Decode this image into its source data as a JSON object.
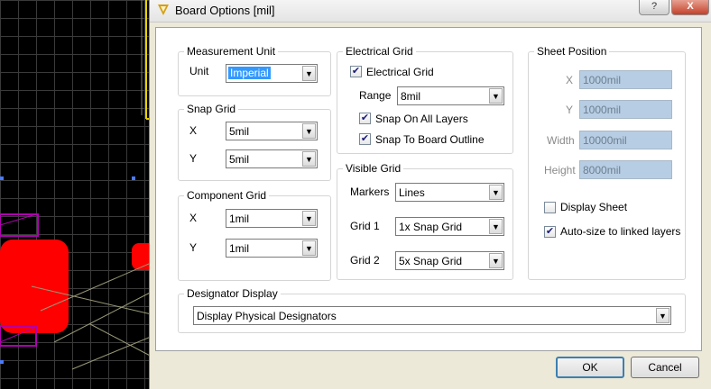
{
  "window": {
    "title": "Board Options [mil]",
    "help_label": "?",
    "close_label": "X"
  },
  "measurement_unit": {
    "group_label": "Measurement Unit",
    "unit_label": "Unit",
    "unit_value": "Imperial"
  },
  "snap_grid": {
    "group_label": "Snap Grid",
    "x_label": "X",
    "x_value": "5mil",
    "y_label": "Y",
    "y_value": "5mil"
  },
  "component_grid": {
    "group_label": "Component Grid",
    "x_label": "X",
    "x_value": "1mil",
    "y_label": "Y",
    "y_value": "1mil"
  },
  "electrical_grid": {
    "group_label": "Electrical Grid",
    "enable_label": "Electrical Grid",
    "enable_checked": true,
    "range_label": "Range",
    "range_value": "8mil",
    "snap_all_layers_label": "Snap On All Layers",
    "snap_all_layers_checked": true,
    "snap_board_outline_label": "Snap To Board Outline",
    "snap_board_outline_checked": true
  },
  "visible_grid": {
    "group_label": "Visible Grid",
    "markers_label": "Markers",
    "markers_value": "Lines",
    "grid1_label": "Grid 1",
    "grid1_value": "1x Snap Grid",
    "grid2_label": "Grid 2",
    "grid2_value": "5x Snap Grid"
  },
  "sheet_position": {
    "group_label": "Sheet Position",
    "x_label": "X",
    "x_value": "1000mil",
    "y_label": "Y",
    "y_value": "1000mil",
    "width_label": "Width",
    "width_value": "10000mil",
    "height_label": "Height",
    "height_value": "8000mil",
    "display_sheet_label": "Display Sheet",
    "display_sheet_checked": false,
    "autosize_label": "Auto-size to linked layers",
    "autosize_checked": true
  },
  "designator_display": {
    "group_label": "Designator Display",
    "value": "Display Physical Designators"
  },
  "buttons": {
    "ok_label": "OK",
    "cancel_label": "Cancel"
  },
  "colors": {
    "pad_red": "#ff0000",
    "pad_outline": "#b000b0",
    "board_outline": "#e6d200",
    "selection_blue": "#3399ff"
  }
}
